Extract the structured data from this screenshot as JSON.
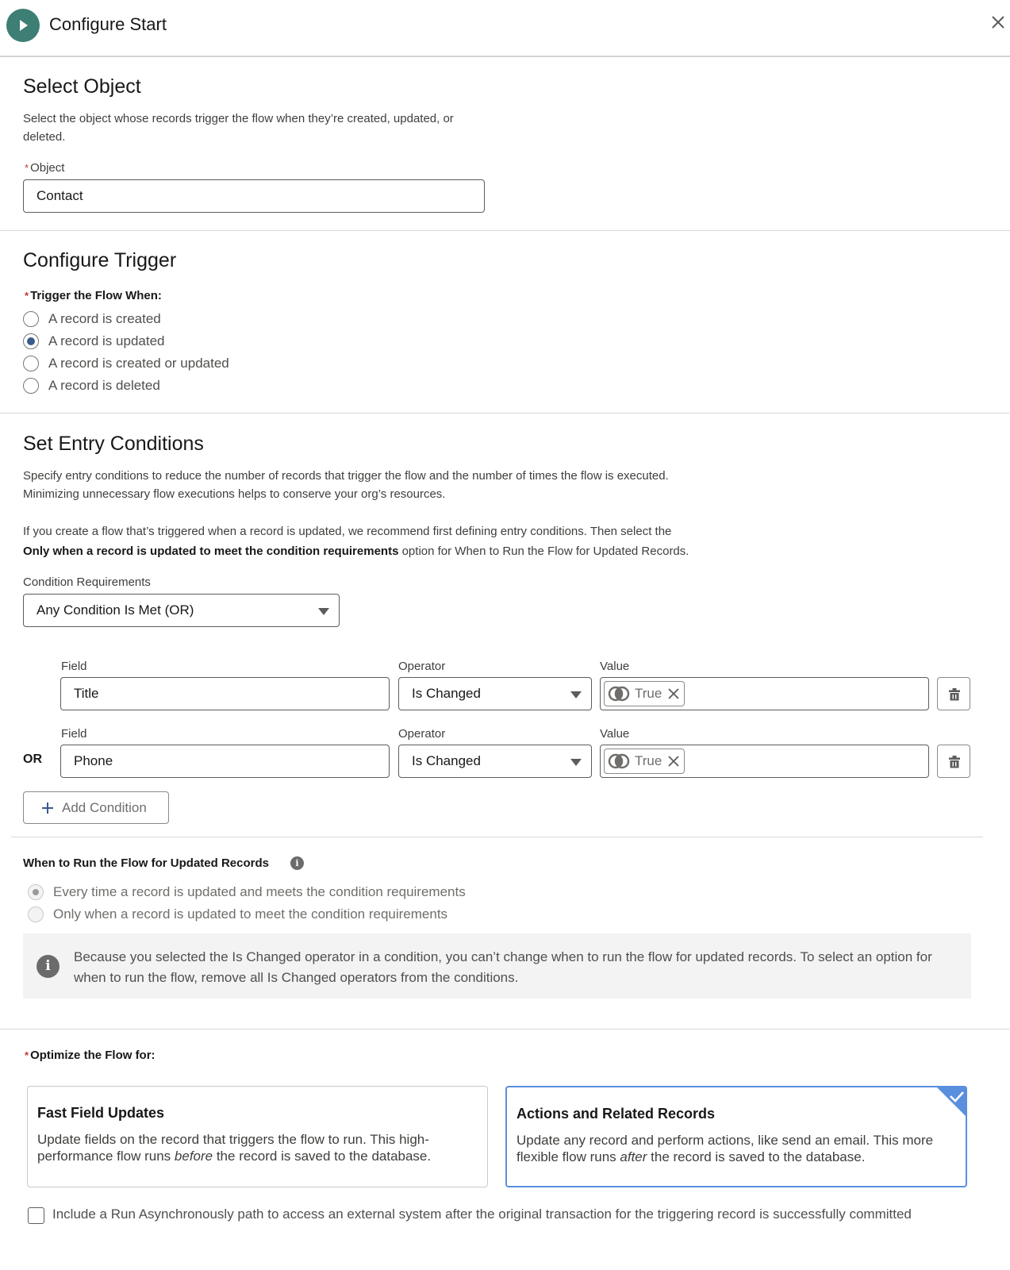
{
  "header": {
    "title": "Configure Start",
    "icon": "play-icon",
    "close_icon": "close-icon"
  },
  "select_object": {
    "heading": "Select Object",
    "description_line1": "Select the object whose records trigger the flow when they’re created, updated, or",
    "description_line2": "deleted.",
    "object_label": "Object",
    "object_value": "Contact"
  },
  "configure_trigger": {
    "heading": "Configure Trigger",
    "label": "Trigger the Flow When:",
    "options": [
      {
        "label": "A record is created",
        "checked": false
      },
      {
        "label": "A record is updated",
        "checked": true
      },
      {
        "label": "A record is created or updated",
        "checked": false
      },
      {
        "label": "A record is deleted",
        "checked": false
      }
    ]
  },
  "entry_conditions": {
    "heading": "Set Entry Conditions",
    "description_line1": "Specify entry conditions to reduce the number of records that trigger the flow and the number of times the flow is executed.",
    "description_line2": "Minimizing unnecessary flow executions helps to conserve your org’s resources.",
    "recommend_line1": "If you create a flow that’s triggered when a record is updated, we recommend first defining entry conditions. Then select the",
    "recommend_bold": "Only when a record is updated to meet the condition requirements",
    "recommend_rest": " option for When to Run the Flow for Updated Records.",
    "requirements_label": "Condition Requirements",
    "requirements_value": "Any Condition Is Met (OR)",
    "field_label": "Field",
    "operator_label": "Operator",
    "value_label": "Value",
    "or_label": "OR",
    "conditions": [
      {
        "field": "Title",
        "operator": "Is Changed",
        "value": "True"
      },
      {
        "field": "Phone",
        "operator": "Is Changed",
        "value": "True"
      }
    ],
    "add_condition_label": "Add Condition"
  },
  "when_to_run": {
    "heading": "When to Run the Flow for Updated Records",
    "options": [
      {
        "label": "Every time a record is updated and meets the condition requirements",
        "checked": true,
        "disabled": true
      },
      {
        "label": "Only when a record is updated to meet the condition requirements",
        "checked": false,
        "disabled": true
      }
    ],
    "notice_text": "Because you selected the Is Changed operator in a condition, you can’t change when to run the flow for updated records. To select an option for when to run the flow, remove all Is Changed operators from the conditions."
  },
  "optimize": {
    "label": "Optimize the Flow for:",
    "cards": [
      {
        "title": "Fast Field Updates",
        "desc_pre": "Update fields on the record that triggers the flow to run. This high-performance flow runs ",
        "desc_em": "before",
        "desc_post": " the record is saved to the database.",
        "selected": false
      },
      {
        "title": "Actions and Related Records",
        "desc_pre": "Update any record and perform actions, like send an email. This more flexible flow runs ",
        "desc_em": "after",
        "desc_post": " the record is saved to the database.",
        "selected": true
      }
    ],
    "async_label": "Include a Run Asynchronously path to access an external system after the original transaction for the triggering record is successfully committed",
    "async_checked": false
  },
  "colors": {
    "start_icon": "#3d7e75",
    "selected_card": "#5a8fde",
    "radio_checked": "#3a5a8c",
    "required": "#c23934"
  }
}
